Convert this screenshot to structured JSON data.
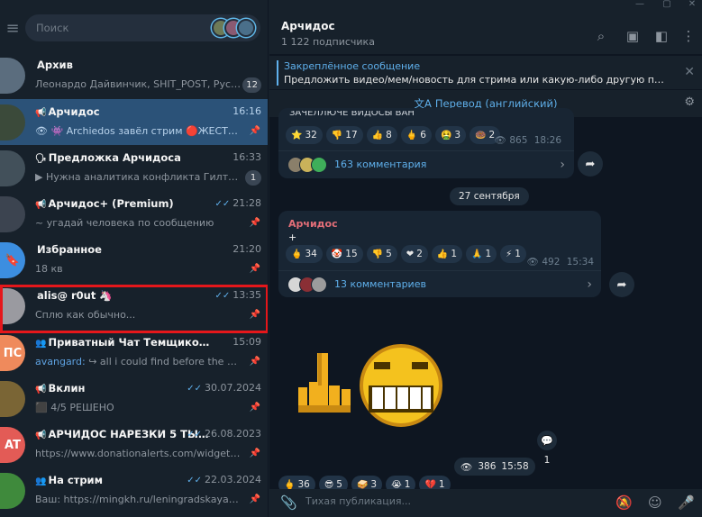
{
  "sidebar": {
    "search_placeholder": "Поиск",
    "chats": [
      {
        "avatar_text": "",
        "avatar_color": "#5b6d7e",
        "kind": "",
        "title": "Архив",
        "time": "",
        "prefix": "",
        "subtitle": "Леонардо Дайвинчик, SHIT_POST, Русски...",
        "badge": "12"
      },
      {
        "avatar_text": "",
        "avatar_color": "#3b4a3a",
        "kind": "📢",
        "title": "Арчидос",
        "time": "16:16",
        "prefix": "",
        "subtitle": "👁 👾 Archiedos завёл стрим 🔴ЖЕСТЬ...",
        "badge": ""
      },
      {
        "avatar_text": "",
        "avatar_color": "#42505a",
        "kind": "🗣",
        "title": "Предложка Арчидоса",
        "time": "16:33",
        "prefix": "",
        "subtitle": "▶ Нужна аналитика конфликта Гилтик...",
        "badge": "1"
      },
      {
        "avatar_text": "",
        "avatar_color": "#3c4450",
        "kind": "📢",
        "title": "Арчидос+ (Premium)",
        "time": "21:28",
        "prefix": "",
        "subtitle": "~ угадай человека по сообщению",
        "badge": ""
      },
      {
        "avatar_text": "🔖",
        "avatar_color": "#3c8ee0",
        "kind": "",
        "title": "Избранное",
        "time": "21:20",
        "prefix": "",
        "subtitle": "18 кв",
        "badge": ""
      },
      {
        "avatar_text": "",
        "avatar_color": "#9a9aa0",
        "kind": "",
        "title": "alis@ r0ut 🦄",
        "time": "13:35",
        "prefix": "",
        "subtitle": "Сплю как обычно...",
        "badge": ""
      },
      {
        "avatar_text": "ПС",
        "avatar_color": "#ef8a5c",
        "kind": "👥",
        "title": "Приватный Чат Темщиков (ПЧТ) Chat",
        "time": "15:09",
        "prefix": "avangard: ",
        "subtitle": "↪ all i could find before the offici...",
        "badge": ""
      },
      {
        "avatar_text": "",
        "avatar_color": "#7a6535",
        "kind": "📢",
        "title": "Вклин",
        "time": "30.07.2024",
        "prefix": "",
        "subtitle": "⬛ 4/5 РЕШЕНО",
        "badge": ""
      },
      {
        "avatar_text": "AT",
        "avatar_color": "#e35b56",
        "kind": "📢",
        "title": "АРЧИДОС НАРЕЗКИ 5 ТЫЩ ...",
        "time": "26.08.2023",
        "prefix": "",
        "subtitle": "https://www.donationalerts.com/widget/ale...",
        "badge": ""
      },
      {
        "avatar_text": "",
        "avatar_color": "#3f8a3c",
        "kind": "👥",
        "title": "На стрим",
        "time": "22.03.2024",
        "prefix": "",
        "subtitle": "Ваш: https://mingkh.ru/leningradskaya-obla...",
        "badge": ""
      }
    ]
  },
  "header": {
    "channel_name": "Арчидос",
    "subscribers": "1 122 подписчика"
  },
  "pinned": {
    "title": "Закреплённое сообщение",
    "text": "Предложить видео/мем/новость для стрима или какую-либо другую полезную..."
  },
  "translate_label": "Перевод (английский)",
  "post1": {
    "top_text": "ЗАЧЕЛЛЮЧЕ ВИДОСЫ ВАН",
    "reactions": [
      {
        "emoji": "⭐",
        "count": "32"
      },
      {
        "emoji": "👎",
        "count": "17"
      },
      {
        "emoji": "👍",
        "count": "8"
      },
      {
        "emoji": "🖕",
        "count": "6"
      },
      {
        "emoji": "🤮",
        "count": "3"
      },
      {
        "emoji": "🍩",
        "count": "2"
      }
    ],
    "views": "865",
    "time": "18:26",
    "comments": "163 комментария"
  },
  "date_separator": "27 сентября",
  "post2": {
    "author": "Арчидос",
    "text": "+",
    "reactions": [
      {
        "emoji": "🖕",
        "count": "34"
      },
      {
        "emoji": "🤡",
        "count": "15"
      },
      {
        "emoji": "👎",
        "count": "5"
      },
      {
        "emoji": "❤",
        "count": "2"
      },
      {
        "emoji": "👍",
        "count": "1"
      },
      {
        "emoji": "🙏",
        "count": "1"
      },
      {
        "emoji": "⚡",
        "count": "1"
      }
    ],
    "views": "492",
    "time": "15:34",
    "comments": "13 комментариев"
  },
  "sticker": {
    "views": "386",
    "time": "15:58",
    "comments_count": "1"
  },
  "bottom_reactions": [
    {
      "emoji": "🖕",
      "count": "36"
    },
    {
      "emoji": "😎",
      "count": "5"
    },
    {
      "emoji": "🥪",
      "count": "3"
    },
    {
      "emoji": "😭",
      "count": "1"
    },
    {
      "emoji": "💔",
      "count": "1"
    }
  ],
  "compose_placeholder": "Тихая публикация..."
}
